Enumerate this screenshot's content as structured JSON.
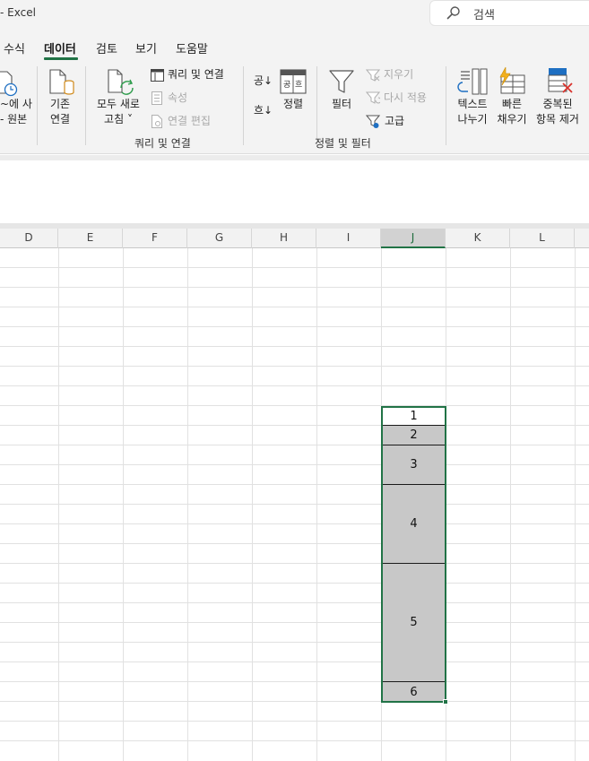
{
  "titlebar": {
    "app_title": "- Excel",
    "search_placeholder": "검색"
  },
  "tabs": [
    {
      "label": "수식",
      "active": false
    },
    {
      "label": "데이터",
      "active": true
    },
    {
      "label": "검토",
      "active": false
    },
    {
      "label": "보기",
      "active": false
    },
    {
      "label": "도움말",
      "active": false
    }
  ],
  "ribbon": {
    "get_data_cut": {
      "line1": "~에 사",
      "line2": "- 원본"
    },
    "existing_connections": {
      "line1": "기존",
      "line2": "연결"
    },
    "refresh_all": {
      "line1": "모두 새로",
      "line2": "고침 ˅"
    },
    "queries_connections": "쿼리 및 연결",
    "properties": "속성",
    "edit_links": "연결 편집",
    "group_queries": "쿼리 및 연결",
    "sort_az": "공↓",
    "sort_za": "흐↓",
    "sort": "정렬",
    "filter": "필터",
    "clear": "지우기",
    "reapply": "다시 적용",
    "advanced": "고급",
    "group_sort_filter": "정렬 및 필터",
    "text_to_columns": {
      "line1": "텍스트",
      "line2": "나누기"
    },
    "flash_fill": {
      "line1": "빠른",
      "line2": "채우기"
    },
    "remove_duplicates": {
      "line1": "중복된",
      "line2": "항목 제거"
    }
  },
  "columns": [
    "D",
    "E",
    "F",
    "G",
    "H",
    "I",
    "J",
    "K",
    "L"
  ],
  "selected_column": "J",
  "selected_cells": [
    "1",
    "2",
    "3",
    "4",
    "5",
    "6"
  ],
  "colors": {
    "accent": "#217346",
    "selected_fill": "#c8c8c8",
    "ribbon_bg": "#f3f3f3"
  }
}
